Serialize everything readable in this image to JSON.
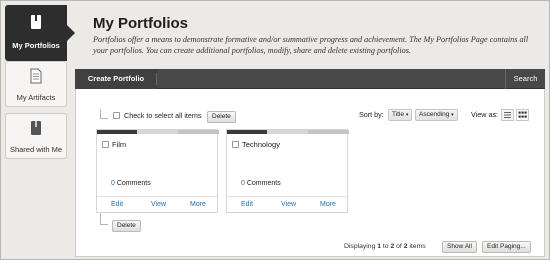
{
  "nav": {
    "active": {
      "label": "My Portfolios",
      "icon": "portfolio-book-icon"
    },
    "items": [
      {
        "label": "My Artifacts",
        "icon": "document-icon"
      },
      {
        "label": "Shared with Me",
        "icon": "shared-book-icon"
      }
    ]
  },
  "header": {
    "title": "My Portfolios",
    "description": "Portfolios offer a means to demonstrate formative and/or summative progress and achievement. The My Portfolios Page contains all your portfolios. You can create additional portfolios, modify, share and delete existing portfolios."
  },
  "action_bar": {
    "create_label": "Create Portfolio",
    "search_label": "Search"
  },
  "toolbar": {
    "select_all_label": "Check to select all items",
    "delete_label": "Delete",
    "sort_by_label": "Sort by:",
    "sort_field": "Title",
    "sort_order": "Ascending",
    "view_as_label": "View as:"
  },
  "cards": [
    {
      "title": "Film",
      "comments_count": "0",
      "comments_label": "Comments",
      "actions": [
        "Edit",
        "View",
        "More"
      ]
    },
    {
      "title": "Technology",
      "comments_count": "0",
      "comments_label": "Comments",
      "actions": [
        "Edit",
        "View",
        "More"
      ]
    }
  ],
  "bottom": {
    "delete_label": "Delete",
    "displaying_prefix": "Displaying",
    "range_start": "1",
    "to_label": "to",
    "range_end": "2",
    "of_label": "of",
    "total": "2",
    "items_label": "items",
    "show_all_label": "Show All",
    "edit_paging_label": "Edit Paging..."
  },
  "colors": {
    "accent_link": "#2b6fa1",
    "nav_active_bg": "#2d2d2d",
    "action_bar_bg": "#484848"
  }
}
